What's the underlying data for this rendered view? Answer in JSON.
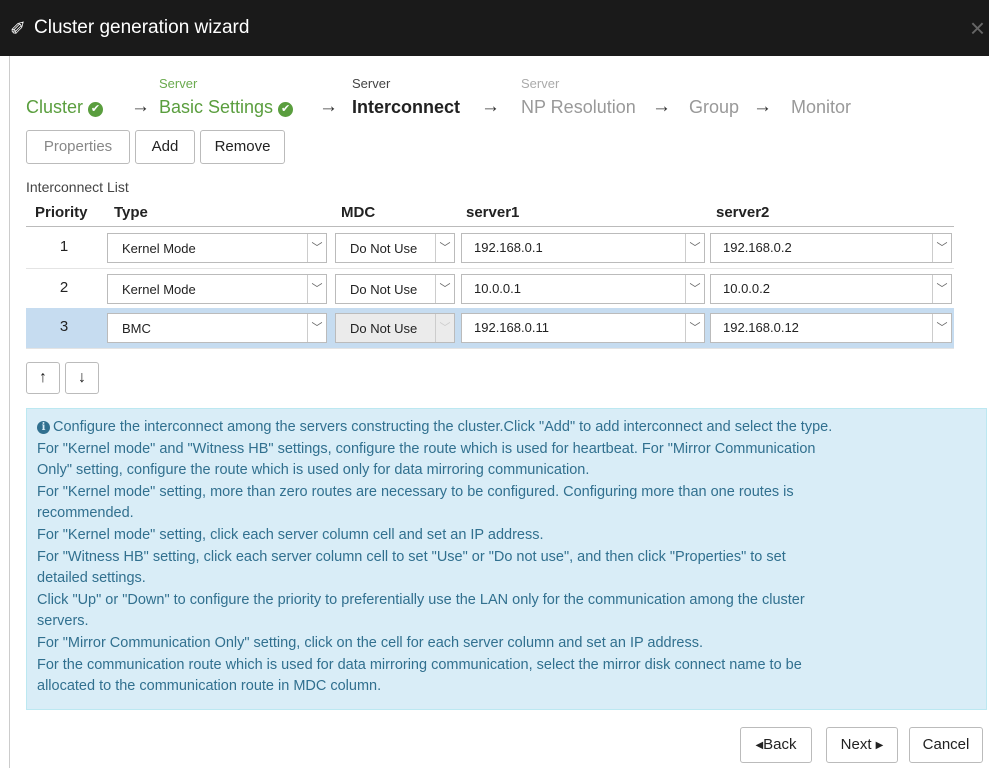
{
  "window": {
    "title": "Cluster generation wizard",
    "close_glyph": "×"
  },
  "steps": [
    {
      "label": "Cluster",
      "sublabel": "",
      "state": "done"
    },
    {
      "label": "Basic Settings",
      "sublabel": "Server",
      "state": "done"
    },
    {
      "label": "Interconnect",
      "sublabel": "Server",
      "state": "current"
    },
    {
      "label": "NP Resolution",
      "sublabel": "Server",
      "state": "pending"
    },
    {
      "label": "Group",
      "sublabel": "",
      "state": "pending"
    },
    {
      "label": "Monitor",
      "sublabel": "",
      "state": "pending"
    }
  ],
  "toolbar": {
    "properties_label": "Properties",
    "add_label": "Add",
    "remove_label": "Remove"
  },
  "list": {
    "label": "Interconnect List",
    "columns": {
      "priority": "Priority",
      "type": "Type",
      "mdc": "MDC",
      "server1": "server1",
      "server2": "server2"
    },
    "rows": [
      {
        "priority": "1",
        "type": "Kernel Mode",
        "mdc": "Do Not Use",
        "server1": "192.168.0.1",
        "server2": "192.168.0.2",
        "selected": false
      },
      {
        "priority": "2",
        "type": "Kernel Mode",
        "mdc": "Do Not Use",
        "server1": "10.0.0.1",
        "server2": "10.0.0.2",
        "selected": false
      },
      {
        "priority": "3",
        "type": "BMC",
        "mdc": "Do Not Use",
        "server1": "192.168.0.11",
        "server2": "192.168.0.12",
        "selected": true
      }
    ]
  },
  "move": {
    "up_glyph": "↑",
    "down_glyph": "↓"
  },
  "info": {
    "lines": [
      "Configure the interconnect among the servers constructing the cluster.Click \"Add\" to add interconnect and select the type.",
      "For \"Kernel mode\" and \"Witness HB\" settings, configure the route which is used for heartbeat. For \"Mirror Communication",
      "Only\" setting, configure the route which is used only for data mirroring communication.",
      "For \"Kernel mode\" setting, more than zero routes are necessary to be configured. Configuring more than one routes is",
      "recommended.",
      "For \"Kernel mode\" setting, click each server column cell and set an IP address.",
      "For \"Witness HB\" setting, click each server column cell to set \"Use\" or \"Do not use\", and then click \"Properties\" to set",
      "detailed settings.",
      "Click \"Up\" or \"Down\" to configure the priority to preferentially use the LAN only for the communication among the cluster",
      "servers.",
      "For \"Mirror Communication Only\" setting, click on the cell for each server column and set an IP address.",
      "For the communication route which is used for data mirroring communication, select the mirror disk connect name to be",
      "allocated to the communication route in MDC column."
    ]
  },
  "footer": {
    "back_label": "Back",
    "next_label": "Next",
    "cancel_label": "Cancel"
  },
  "colors": {
    "done": "#5a9e3e",
    "selected_row": "#c6dcf0",
    "info_bg": "#d9edf7",
    "info_text": "#31708f",
    "titlebar": "#1a1a1a"
  }
}
